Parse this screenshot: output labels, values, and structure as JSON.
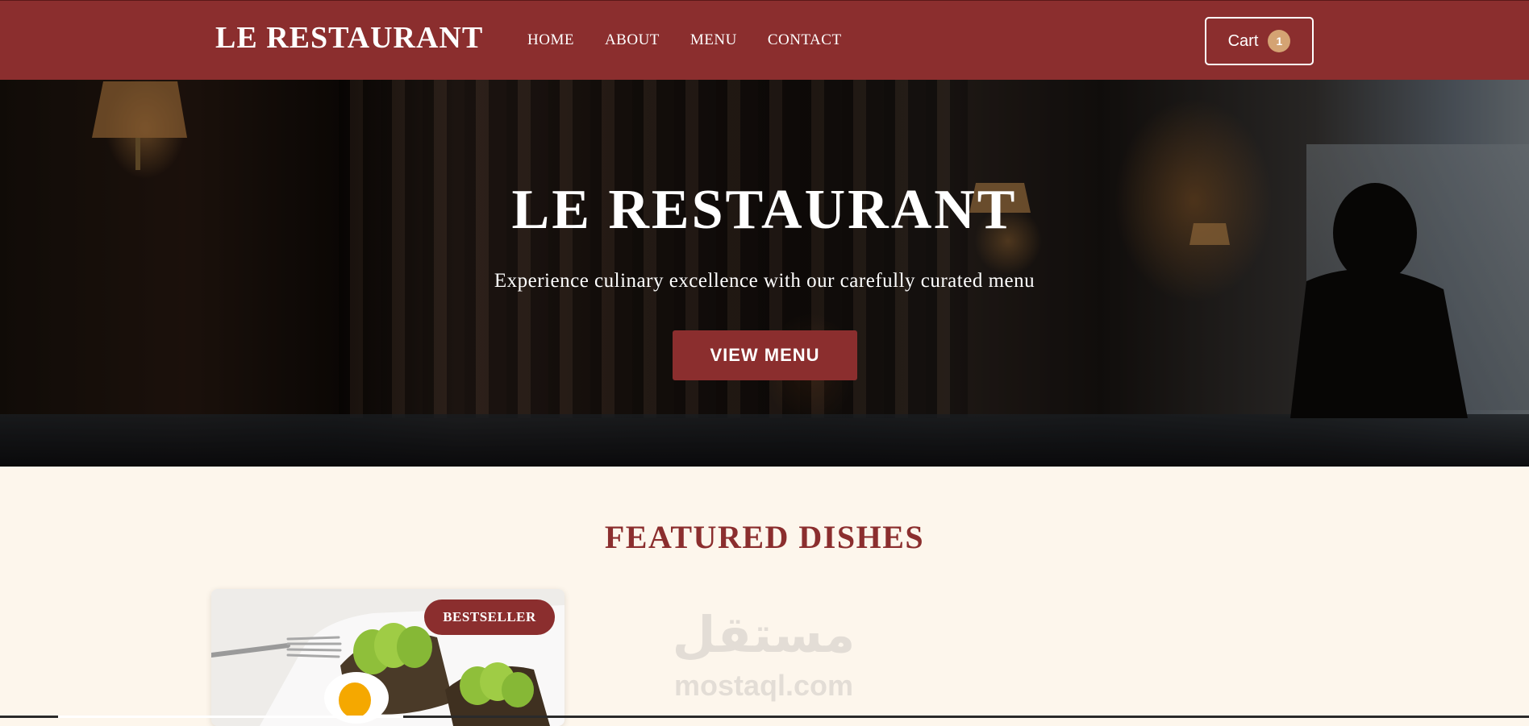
{
  "navbar": {
    "brand": "LE RESTAURANT",
    "links": [
      "HOME",
      "ABOUT",
      "MENU",
      "CONTACT"
    ],
    "cart_label": "Cart",
    "cart_count": "1"
  },
  "hero": {
    "title": "LE RESTAURANT",
    "subtitle": "Experience culinary excellence with our carefully curated menu",
    "cta_label": "VIEW MENU"
  },
  "featured": {
    "title": "FEATURED DISHES",
    "cards": [
      {
        "badge": "BESTSELLER"
      }
    ]
  },
  "watermark": {
    "arabic": "مستقل",
    "latin": "mostaql.com"
  },
  "colors": {
    "brand": "#8b2e2e",
    "background": "#fdf6ec",
    "badge_accent": "#d4a373"
  },
  "icons": [
    "restaurant-photo",
    "avocado-toast-photo"
  ]
}
